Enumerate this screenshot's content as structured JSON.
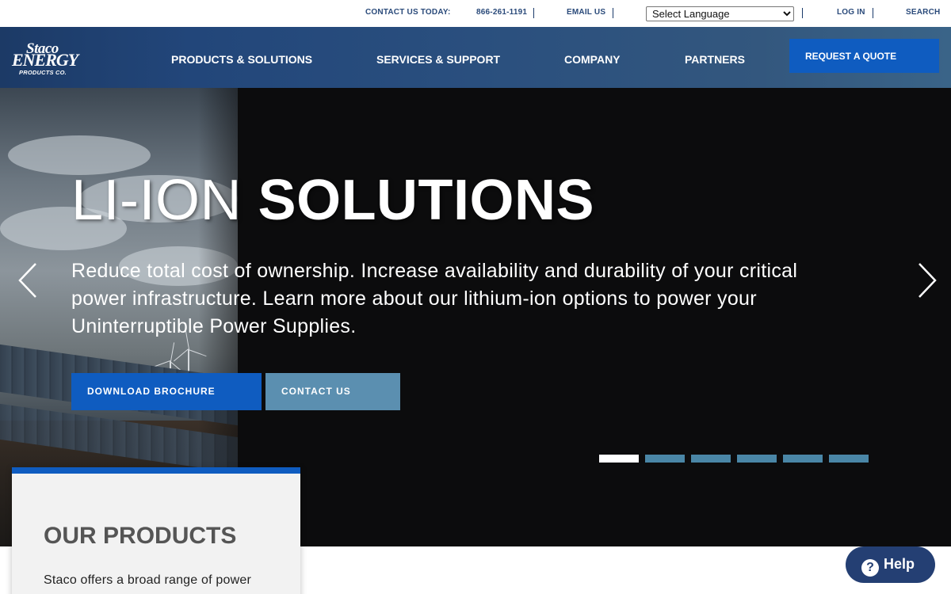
{
  "utility_bar": {
    "contact_label": "CONTACT US TODAY:",
    "phone": "866-261-1191",
    "email_label": "EMAIL US",
    "language_select": "Select Language",
    "login_label": "LOG IN",
    "search_label": "SEARCH"
  },
  "header": {
    "logo_line1": "Staco",
    "logo_line2": "ENERGY",
    "logo_line3": "PRODUCTS CO.",
    "nav": [
      {
        "label": "PRODUCTS & SOLUTIONS"
      },
      {
        "label": "SERVICES & SUPPORT"
      },
      {
        "label": "COMPANY"
      },
      {
        "label": "PARTNERS"
      }
    ],
    "quote_label": "REQUEST A QUOTE"
  },
  "hero": {
    "title_light": "LI-ION",
    "title_bold": "SOLUTIONS",
    "text": "Reduce total cost of ownership. Increase availability and durability of your critical power infrastructure. Learn more about our lithium-ion options to power your Uninterruptible Power Supplies.",
    "download_label": "DOWNLOAD BROCHURE",
    "contact_label": "CONTACT US",
    "slide_count": 6,
    "active_slide": 1
  },
  "products": {
    "title_light": "OUR",
    "title_bold": "PRODUCTS",
    "text": "Staco offers a broad range of power"
  },
  "help": {
    "icon_glyph": "?",
    "label": "Help"
  },
  "colors": {
    "brand_blue": "#0f5cc0",
    "contact_button": "#5b8fb0",
    "header_navy": "#22467a",
    "help_navy": "#243f73",
    "slider_dot": "#4a86a6"
  }
}
